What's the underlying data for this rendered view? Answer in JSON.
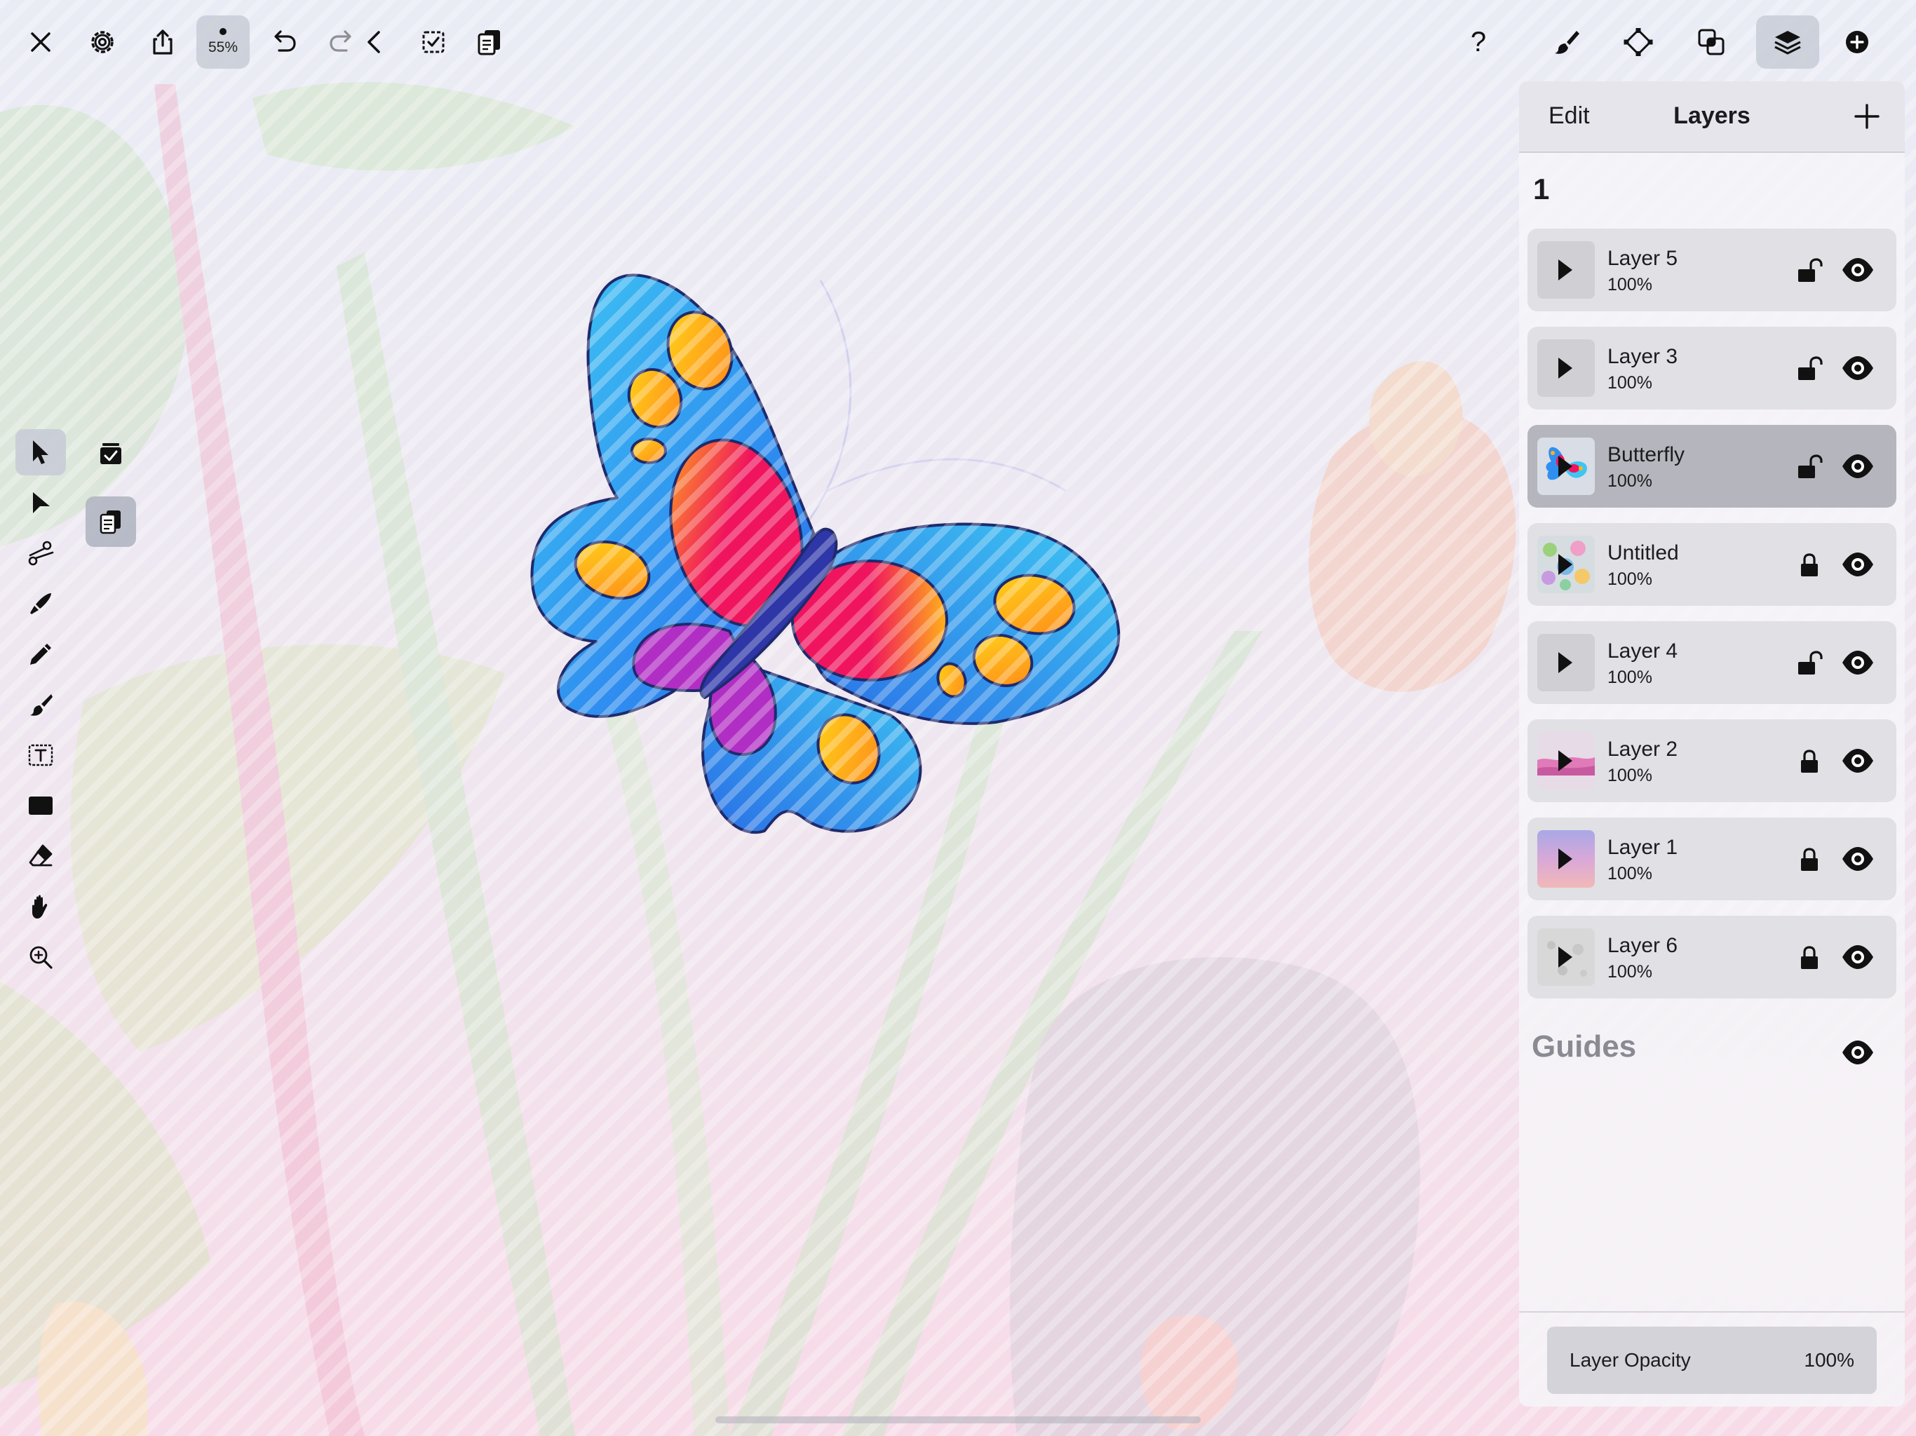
{
  "toolbar": {
    "left_icons": [
      "close-icon",
      "settings-icon",
      "share-icon",
      "undo-icon",
      "redo-icon",
      "back-chevron-icon",
      "select-all-icon",
      "duplicate-icon"
    ],
    "zoom_label": "55%",
    "help_label": "?",
    "right_icons": [
      "brush-icon",
      "anchor-diamond-icon",
      "combine-shapes-icon",
      "layers-icon",
      "add-circle-icon"
    ]
  },
  "tools": [
    "select-arrow-icon",
    "direct-select-icon",
    "scissors-icon",
    "pen-icon",
    "pencil-icon",
    "brush-icon",
    "text-tool-icon",
    "shape-icon",
    "eraser-icon",
    "hand-icon",
    "zoom-icon"
  ],
  "layers_panel": {
    "edit_label": "Edit",
    "title": "Layers",
    "group_label": "1",
    "layers": [
      {
        "name": "Layer 5",
        "opacity": "100%",
        "locked": false,
        "selected": false
      },
      {
        "name": "Layer 3",
        "opacity": "100%",
        "locked": false,
        "selected": false
      },
      {
        "name": "Butterfly",
        "opacity": "100%",
        "locked": false,
        "selected": true
      },
      {
        "name": "Untitled",
        "opacity": "100%",
        "locked": true,
        "selected": false
      },
      {
        "name": "Layer 4",
        "opacity": "100%",
        "locked": false,
        "selected": false
      },
      {
        "name": "Layer 2",
        "opacity": "100%",
        "locked": true,
        "selected": false
      },
      {
        "name": "Layer 1",
        "opacity": "100%",
        "locked": true,
        "selected": false
      },
      {
        "name": "Layer 6",
        "opacity": "100%",
        "locked": true,
        "selected": false
      }
    ],
    "guides_label": "Guides",
    "opacity_label": "Layer Opacity",
    "opacity_value": "100%"
  },
  "colors": {
    "butterfly_blue_light": "#3ec6f2",
    "butterfly_blue_dark": "#2a6fe6",
    "butterfly_pink": "#f0145e",
    "butterfly_orange": "#ffb11a",
    "butterfly_purple": "#b12ec4",
    "butterfly_body": "#2e36a8",
    "panel_bg": "#f6f4f8"
  }
}
